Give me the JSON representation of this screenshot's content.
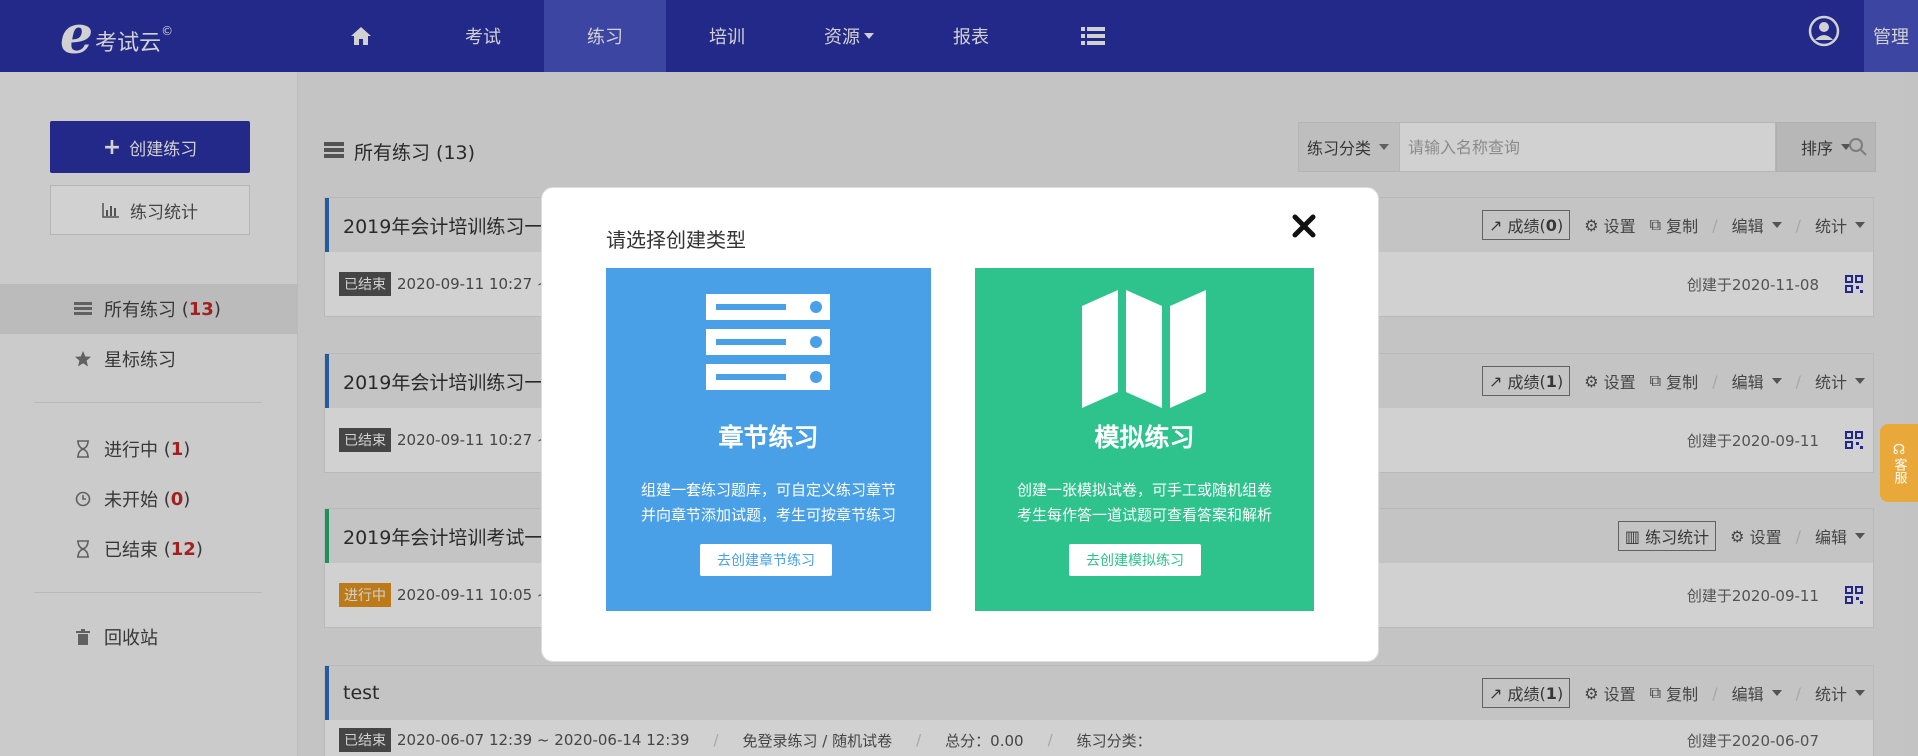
{
  "logo": {
    "letter": "e",
    "name": "考试云",
    "copyright": "©"
  },
  "nav": {
    "items": [
      {
        "label": "",
        "icon": "home-icon"
      },
      {
        "label": "考试"
      },
      {
        "label": "练习",
        "active": true
      },
      {
        "label": "培训"
      },
      {
        "label": "资源"
      },
      {
        "label": "报表"
      },
      {
        "label": "",
        "icon": "list-icon"
      }
    ],
    "admin": "管理"
  },
  "sidebar": {
    "create_label": "创建练习",
    "stats_label": "练习统计",
    "items": [
      {
        "label": "所有练习",
        "count": "13",
        "icon": "list-icon"
      },
      {
        "label": "星标练习",
        "icon": "star-icon"
      },
      {
        "label": "进行中",
        "count": "1",
        "icon": "hourglass-icon"
      },
      {
        "label": "未开始",
        "count": "0",
        "icon": "clock-icon"
      },
      {
        "label": "已结束",
        "count": "12",
        "icon": "hourglass-icon"
      },
      {
        "label": "回收站",
        "icon": "trash-icon"
      }
    ]
  },
  "main": {
    "title": "所有练习 (13)",
    "search": {
      "category": "练习分类",
      "placeholder": "请输入名称查询",
      "sort_label": "排序"
    },
    "cards": [
      {
        "title": "2019年会计培训练习一（",
        "status": "已结束",
        "time": "2020-09-11 10:27 ~",
        "created": "创建于2020-11-08",
        "actions": {
          "score": "成绩",
          "score_count": "0",
          "settings": "设置",
          "copy": "复制",
          "edit": "编辑",
          "stats": "统计"
        }
      },
      {
        "title": "2019年会计培训练习一（",
        "status": "已结束",
        "time": "2020-09-11 10:27 ~",
        "created": "创建于2020-09-11",
        "actions": {
          "score": "成绩",
          "score_count": "1",
          "settings": "设置",
          "copy": "复制",
          "edit": "编辑",
          "stats": "统计"
        }
      },
      {
        "title": "2019年会计培训考试一",
        "status": "进行中",
        "time": "2020-09-11 10:05 ~",
        "created": "创建于2020-09-11",
        "actions": {
          "practice_stats": "练习统计",
          "settings": "设置",
          "edit": "编辑"
        }
      },
      {
        "title": "test",
        "status": "已结束",
        "time": "2020-06-07 12:39 ~ 2020-06-14 12:39",
        "extra": "免登录练习 / 随机试卷",
        "total": "总分：0.00",
        "category": "练习分类：",
        "created": "创建于2020-06-07",
        "actions": {
          "score": "成绩",
          "score_count": "1",
          "settings": "设置",
          "copy": "复制",
          "edit": "编辑",
          "stats": "统计"
        }
      }
    ]
  },
  "modal": {
    "title": "请选择创建类型",
    "options": [
      {
        "title": "章节练习",
        "desc_line1": "组建一套练习题库，可自定义练习章节",
        "desc_line2": "并向章节添加试题，考生可按章节练习",
        "button": "去创建章节练习",
        "icon": "server-list-icon",
        "color": "#4aa0e6"
      },
      {
        "title": "模拟练习",
        "desc_line1": "创建一张模拟试卷，可手工或随机组卷",
        "desc_line2": "考生每作答一道试题可查看答案和解析",
        "button": "去创建模拟练习",
        "icon": "map-icon",
        "color": "#2ec38d"
      }
    ]
  },
  "service_label": "客服",
  "colors": {
    "primary": "#2b33a6",
    "nav_active": "#4a55c6",
    "blue_card": "#4aa0e6",
    "green_card": "#2ec38d",
    "badge_running": "#e6951f",
    "service": "#e8a93a"
  }
}
